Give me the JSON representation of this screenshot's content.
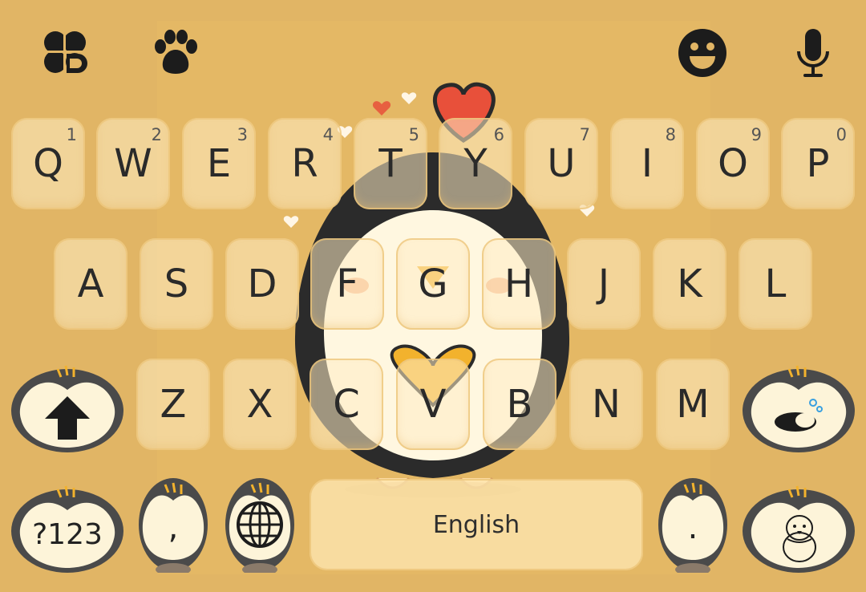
{
  "theme": {
    "background": "#e1b565",
    "key_fill": "#fbe3b6",
    "penguin_dark": "#4a4a4a",
    "penguin_light": "#fdf4d9",
    "heart_red": "#e8503a"
  },
  "toolbar": {
    "left_icons": [
      "clover-icon",
      "paw-icon"
    ],
    "right_icons": [
      "emoji-icon",
      "microphone-icon"
    ]
  },
  "rows": {
    "row1": [
      {
        "label": "Q",
        "hint": "1"
      },
      {
        "label": "W",
        "hint": "2"
      },
      {
        "label": "E",
        "hint": "3"
      },
      {
        "label": "R",
        "hint": "4"
      },
      {
        "label": "T",
        "hint": "5"
      },
      {
        "label": "Y",
        "hint": "6"
      },
      {
        "label": "U",
        "hint": "7"
      },
      {
        "label": "I",
        "hint": "8"
      },
      {
        "label": "O",
        "hint": "9"
      },
      {
        "label": "P",
        "hint": "0"
      }
    ],
    "row2": [
      {
        "label": "A"
      },
      {
        "label": "S"
      },
      {
        "label": "D"
      },
      {
        "label": "F"
      },
      {
        "label": "G"
      },
      {
        "label": "H"
      },
      {
        "label": "J"
      },
      {
        "label": "K"
      },
      {
        "label": "L"
      }
    ],
    "row3": [
      {
        "label": "Z"
      },
      {
        "label": "X"
      },
      {
        "label": "C"
      },
      {
        "label": "V"
      },
      {
        "label": "B"
      },
      {
        "label": "N"
      },
      {
        "label": "M"
      }
    ]
  },
  "bottom": {
    "symbols_label": "?123",
    "comma_label": ",",
    "period_label": ".",
    "space_label": "English"
  }
}
